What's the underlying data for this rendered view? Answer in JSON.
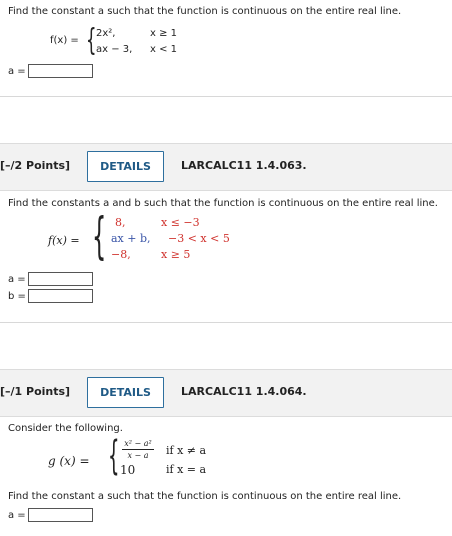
{
  "q1": {
    "prompt": "Find the constant a such that the function is continuous on the entire real line.",
    "fx_label": "f(x) =",
    "case1_expr": "2x²,",
    "case1_cond": "x ≥ 1",
    "case2_expr": "ax − 3,",
    "case2_cond": "x < 1",
    "a_label": "a ="
  },
  "q2": {
    "points": "[–/2 Points]",
    "details_label": "DETAILS",
    "code": "LARCALC11 1.4.063.",
    "prompt": "Find the constants a and b such that the function is continuous on the entire real line.",
    "fx_label": "f(x) =",
    "case1_expr": "8,",
    "case1_cond": "x ≤ −3",
    "case2_expr": "ax + b,",
    "case2_cond": "−3 < x < 5",
    "case3_expr": "−8,",
    "case3_cond": "x ≥ 5",
    "a_label": "a =",
    "b_label": "b ="
  },
  "q3": {
    "points": "[–/1 Points]",
    "details_label": "DETAILS",
    "code": "LARCALC11 1.4.064.",
    "consider": "Consider the following.",
    "gx_label": "g (x) =",
    "frac_num": "x² − a²",
    "frac_den": "x − a",
    "case1_cond": "if x ≠ a",
    "case2_expr": "10",
    "case2_cond": "if x = a",
    "prompt": "Find the constant a such that the function is continuous on the entire real line.",
    "a_label": "a ="
  }
}
